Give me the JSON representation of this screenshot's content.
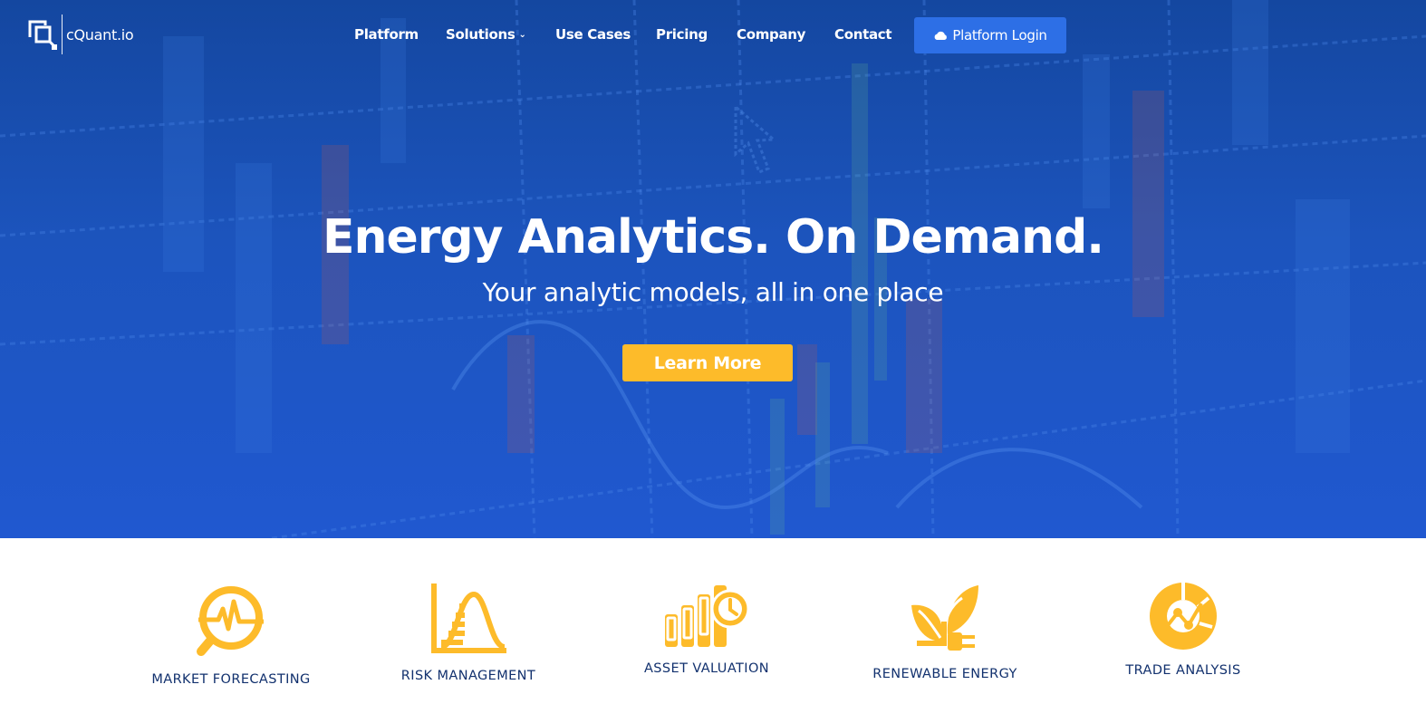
{
  "header": {
    "logo_text": "cQuant.io",
    "nav": [
      {
        "label": "Platform"
      },
      {
        "label": "Solutions"
      },
      {
        "label": "Use Cases"
      },
      {
        "label": "Pricing"
      },
      {
        "label": "Company"
      },
      {
        "label": "Contact"
      }
    ],
    "login_label": "Platform Login"
  },
  "hero": {
    "headline": "Energy Analytics. On Demand.",
    "subheadline": "Your analytic models, all in one place",
    "cta_label": "Learn More"
  },
  "features": [
    {
      "label": "MARKET FORECASTING",
      "icon": "market-forecasting-icon"
    },
    {
      "label": "RISK MANAGEMENT",
      "icon": "risk-management-icon"
    },
    {
      "label": "ASSET VALUATION",
      "icon": "asset-valuation-icon"
    },
    {
      "label": "RENEWABLE ENERGY",
      "icon": "renewable-energy-icon"
    },
    {
      "label": "TRADE ANALYSIS",
      "icon": "trade-analysis-icon"
    }
  ],
  "colors": {
    "hero_blue": "#1c54bd",
    "login_button": "#2d6fe6",
    "accent_yellow": "#fdbb2a",
    "feature_text": "#12316e"
  }
}
